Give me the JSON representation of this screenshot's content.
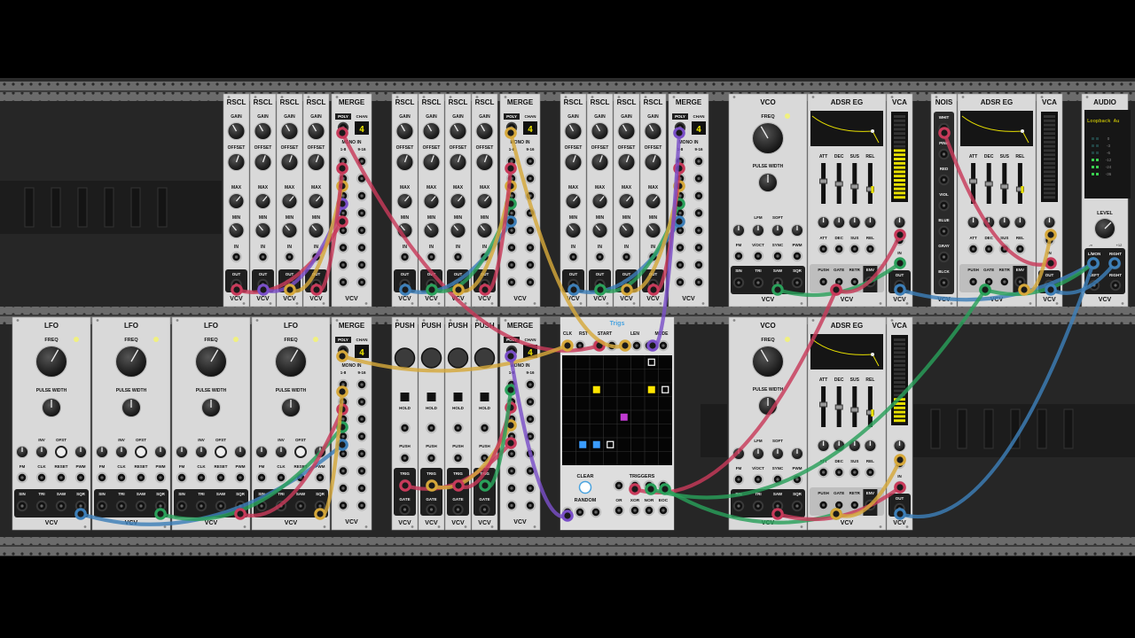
{
  "colors": {
    "background": "#000000",
    "rail": "#5a5a5a",
    "rack_bg": "#2b2b2b",
    "panel": "#d9d9d9",
    "panel_dark": "#1f1f1f",
    "cable_red": "#c83a5a",
    "cable_yellow": "#d6a83a",
    "cable_green": "#2aa05a",
    "cable_blue": "#3d7fb8",
    "cable_purple": "#7a4fc8",
    "vcf_yellow": "#e8e000",
    "trig_yellow": "#ffe600",
    "trig_magenta": "#c03ad0",
    "trig_blue": "#3a9cff",
    "title_blue": "#4aa3df"
  },
  "brand_label": "VCV",
  "rscl": {
    "title": "RSCL",
    "labels": {
      "gain": "GAIN",
      "offset": "OFFSET",
      "max": "MAX",
      "min": "MIN",
      "in": "IN",
      "out": "OUT"
    }
  },
  "merge": {
    "title": "MERGE",
    "poly": "POLY",
    "chan": "CHAN",
    "chan_value": "4",
    "mono_in": "MONO IN",
    "range_a": "1-8",
    "range_b": "9-16"
  },
  "vco": {
    "title": "VCO",
    "freq": "FREQ",
    "pulse_width": "PULSE WIDTH",
    "lfm": "LFM",
    "soft": "SOFT",
    "jacks_top": [
      "FM",
      "V/OCT",
      "SYNC",
      "PWM"
    ],
    "jacks_bottom": [
      "SIN",
      "TRI",
      "SAW",
      "SQR"
    ]
  },
  "lfo": {
    "title": "LFO",
    "freq": "FREQ",
    "pulse_width": "PULSE WIDTH",
    "toggles": [
      "INV",
      "OFST"
    ],
    "jacks_top": [
      "FM",
      "CLK",
      "RESET",
      "PWM"
    ],
    "jacks_bottom": [
      "SIN",
      "TRI",
      "SAW",
      "SQR"
    ]
  },
  "adsr": {
    "title": "ADSR EG",
    "sliders": [
      "ATT",
      "DEC",
      "SUS",
      "REL"
    ],
    "jacks": [
      "PUSH",
      "GATE",
      "RETR",
      "ENV"
    ]
  },
  "vca": {
    "title": "VCA",
    "in": "IN",
    "out": "OUT"
  },
  "nois": {
    "title": "NOIS",
    "outputs": [
      "WHIT",
      "PINK",
      "RED",
      "VIOL",
      "BLUE",
      "GRAY",
      "BLCK"
    ]
  },
  "audio": {
    "title": "AUDIO",
    "device": "Loopback Au",
    "db_marks": [
      "0",
      "-3",
      "-6",
      "-12",
      "-24",
      "-36"
    ],
    "level": "LEVEL",
    "io": [
      "L/MON",
      "IN",
      "RIGHT",
      "LEFT",
      "RIGHT"
    ],
    "level_range": [
      "-∞",
      "+12"
    ]
  },
  "push": {
    "title": "PUSH",
    "hold": "HOLD",
    "push_label": "PUSH",
    "trig": "TRIG",
    "gate": "GATE"
  },
  "trigs": {
    "title": "Trigs",
    "header": [
      "CLK",
      "RST",
      "START",
      "LEN",
      "MODE"
    ],
    "clear": "CLEAR",
    "random": "RANDOM",
    "triggers": "TRIGGERS",
    "logic": [
      "OR",
      "XOR",
      "NOR",
      "EOC"
    ],
    "cells": [
      {
        "col": 2,
        "row": 2,
        "color": "yellow"
      },
      {
        "col": 6,
        "row": 2,
        "color": "yellow"
      },
      {
        "col": 7,
        "row": 2,
        "color": "outline"
      },
      {
        "col": 4,
        "row": 4,
        "color": "magenta"
      },
      {
        "col": 1,
        "row": 6,
        "color": "blue"
      },
      {
        "col": 2,
        "row": 6,
        "color": "blue"
      },
      {
        "col": 3,
        "row": 6,
        "color": "outline"
      },
      {
        "col": 6,
        "row": 0,
        "color": "outline"
      }
    ]
  }
}
